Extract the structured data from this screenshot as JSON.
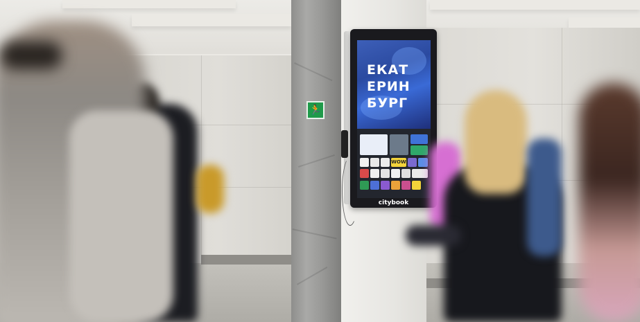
{
  "signage": {
    "screen_words": [
      "ЕКАТ",
      "ЕРИН",
      "БУРГ"
    ],
    "brand": "citybook",
    "tile_badge": "WOW"
  },
  "colors": {
    "exit_sign": "#1f9a4a",
    "screen_accent": "#3a6ad6",
    "kiosk_body": "#1a1a1e"
  },
  "icons": {
    "exit": "running-exit-icon"
  }
}
